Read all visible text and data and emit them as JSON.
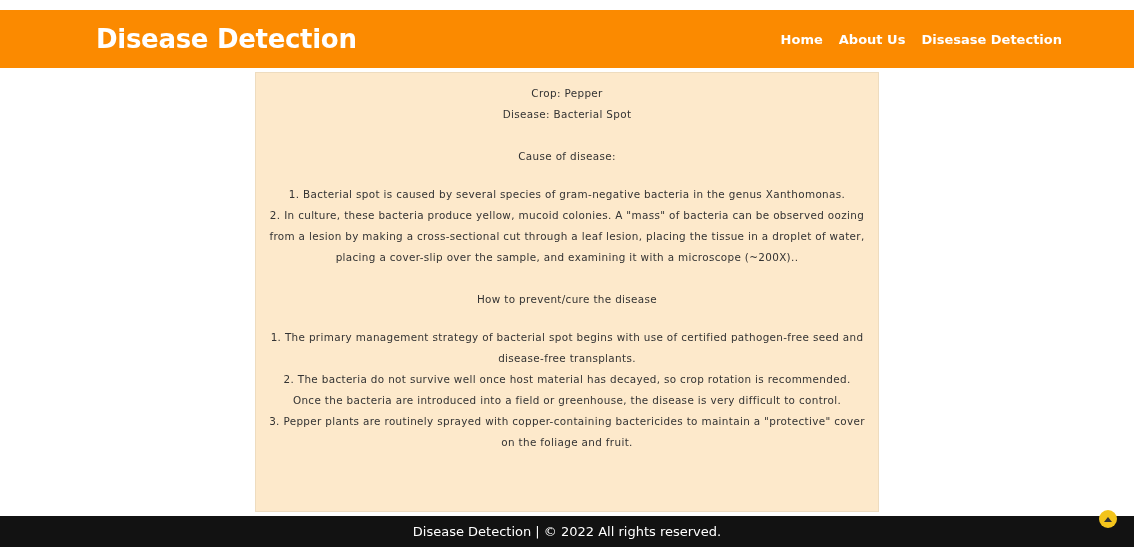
{
  "header": {
    "title": "Disease Detection",
    "nav": [
      {
        "label": "Home"
      },
      {
        "label": "About Us"
      },
      {
        "label": "Disesase Detection"
      }
    ]
  },
  "result": {
    "crop": "Crop: Pepper",
    "disease": "Disease: Bacterial Spot",
    "sections": [
      {
        "heading": "Cause of disease:",
        "items": [
          "1. Bacterial spot is caused by several species of gram-negative bacteria in the genus Xanthomonas.",
          "2. In culture, these bacteria produce yellow, mucoid colonies. A \"mass\" of bacteria can be observed oozing from a lesion by making a cross-sectional cut through a leaf lesion, placing the tissue in a droplet of water, placing a cover-slip over the sample, and examining it with a microscope (~200X).."
        ]
      },
      {
        "heading": "How to prevent/cure the disease",
        "items": [
          "1. The primary management strategy of bacterial spot begins with use of certified pathogen-free seed and disease-free transplants.",
          "2. The bacteria do not survive well once host material has decayed, so crop rotation is recommended. Once the bacteria are introduced into a field or greenhouse, the disease is very difficult to control.",
          "3. Pepper plants are routinely sprayed with copper-containing bactericides to maintain a \"protective\" cover on the foliage and fruit."
        ]
      }
    ]
  },
  "footer": {
    "text": "Disease Detection | © 2022 All rights reserved."
  }
}
